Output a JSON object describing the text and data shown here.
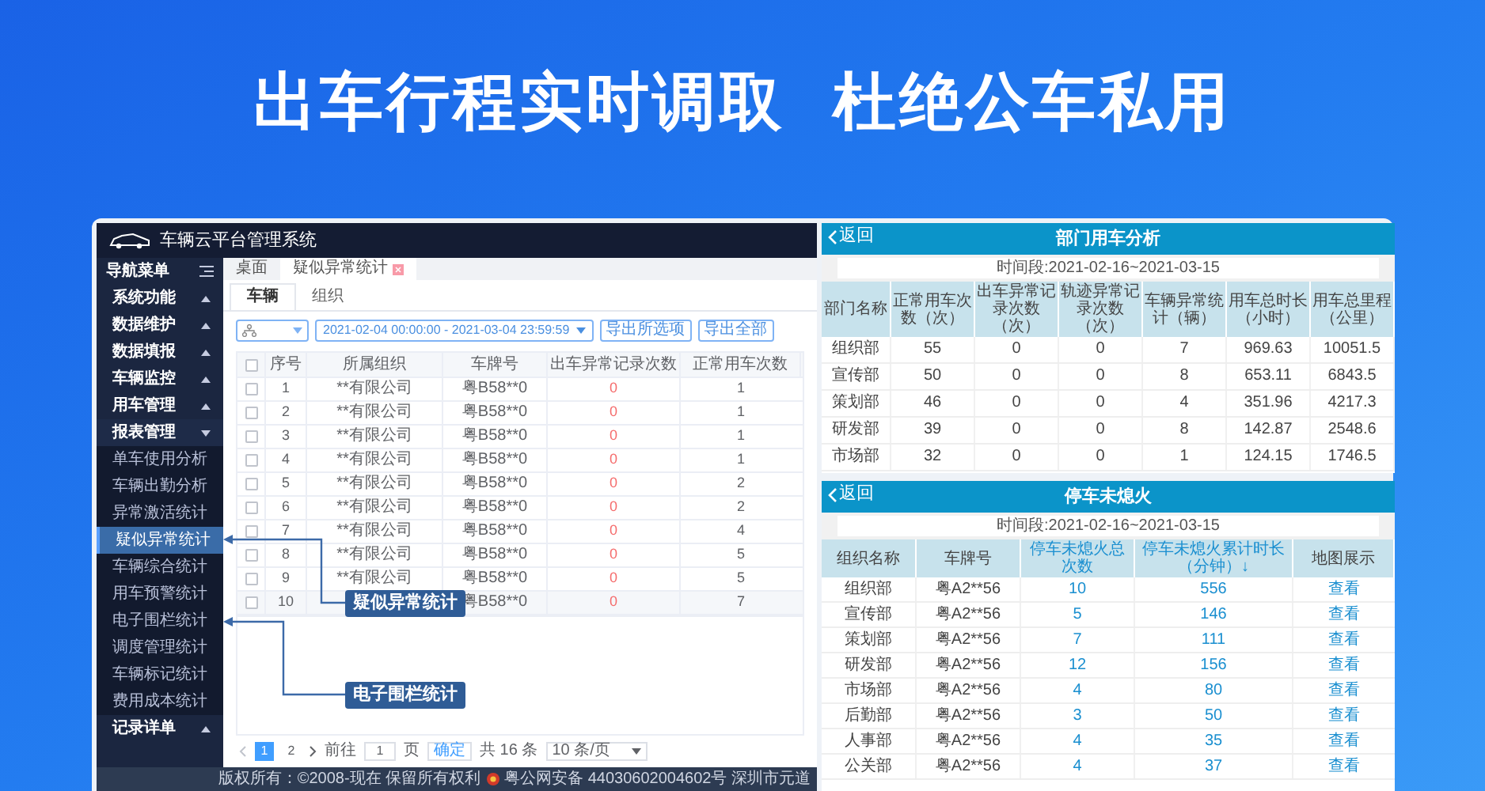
{
  "headline": [
    "出车行程实时调取",
    "杜绝公车私用"
  ],
  "app": {
    "title": "车辆云平台管理系统",
    "sidebar": {
      "title": "导航菜单",
      "items": [
        {
          "label": "系统功能",
          "expanded": false
        },
        {
          "label": "数据维护",
          "expanded": false
        },
        {
          "label": "数据填报",
          "expanded": false
        },
        {
          "label": "车辆监控",
          "expanded": false
        },
        {
          "label": "用车管理",
          "expanded": false
        },
        {
          "label": "报表管理",
          "expanded": true,
          "children": [
            {
              "label": "单车使用分析",
              "selected": false
            },
            {
              "label": "车辆出勤分析",
              "selected": false
            },
            {
              "label": "异常激活统计",
              "selected": false
            },
            {
              "label": "疑似异常统计",
              "selected": true
            },
            {
              "label": "车辆综合统计",
              "selected": false
            },
            {
              "label": "用车预警统计",
              "selected": false
            },
            {
              "label": "电子围栏统计",
              "selected": false
            },
            {
              "label": "调度管理统计",
              "selected": false
            },
            {
              "label": "车辆标记统计",
              "selected": false
            },
            {
              "label": "费用成本统计",
              "selected": false
            }
          ]
        },
        {
          "label": "记录详单",
          "expanded": false
        }
      ]
    },
    "page_tabs": [
      {
        "label": "桌面",
        "selected": false,
        "closable": false
      },
      {
        "label": "疑似异常统计",
        "selected": true,
        "closable": true
      }
    ],
    "view_tabs": [
      {
        "label": "车辆",
        "selected": true
      },
      {
        "label": "组织",
        "selected": false
      }
    ],
    "filters": {
      "date_range": "2021-02-04 00:00:00 - 2021-03-04 23:59:59",
      "buttons": [
        "导出所选项",
        "导出全部"
      ]
    },
    "table": {
      "all_checked": false,
      "columns": [
        "序号",
        "所属组织",
        "车牌号",
        "出车异常记录次数",
        "正常用车次数"
      ],
      "rows": [
        {
          "checked": false,
          "no": "1",
          "org": "**有限公司",
          "plate": "粤B58**0",
          "abnormal": "0",
          "normal": "1"
        },
        {
          "checked": false,
          "no": "2",
          "org": "**有限公司",
          "plate": "粤B58**0",
          "abnormal": "0",
          "normal": "1"
        },
        {
          "checked": false,
          "no": "3",
          "org": "**有限公司",
          "plate": "粤B58**0",
          "abnormal": "0",
          "normal": "1"
        },
        {
          "checked": false,
          "no": "4",
          "org": "**有限公司",
          "plate": "粤B58**0",
          "abnormal": "0",
          "normal": "1"
        },
        {
          "checked": false,
          "no": "5",
          "org": "**有限公司",
          "plate": "粤B58**0",
          "abnormal": "0",
          "normal": "2"
        },
        {
          "checked": false,
          "no": "6",
          "org": "**有限公司",
          "plate": "粤B58**0",
          "abnormal": "0",
          "normal": "2"
        },
        {
          "checked": false,
          "no": "7",
          "org": "**有限公司",
          "plate": "粤B58**0",
          "abnormal": "0",
          "normal": "4"
        },
        {
          "checked": false,
          "no": "8",
          "org": "**有限公司",
          "plate": "粤B58**0",
          "abnormal": "0",
          "normal": "5"
        },
        {
          "checked": false,
          "no": "9",
          "org": "**有限公司",
          "plate": "粤B58**0",
          "abnormal": "0",
          "normal": "5"
        },
        {
          "checked": false,
          "no": "10",
          "plate": "粤B58**0",
          "abnormal": "0",
          "normal": "7"
        }
      ]
    },
    "pagination": {
      "pages": [
        {
          "label": "1",
          "selected": true
        },
        {
          "label": "2",
          "selected": false
        }
      ],
      "goto_label": "前往",
      "goto_value": "1",
      "page_unit": "页",
      "confirm": "确定",
      "total": "共 16 条",
      "page_size": "10 条/页"
    },
    "footer": {
      "copyright": "版权所有：©2008-现在 保留所有权利",
      "record": "粤公网安备 44030602004602号 深圳市元道"
    },
    "callouts": [
      "疑似异常统计",
      "电子围栏统计"
    ]
  },
  "panels": [
    {
      "back": "返回",
      "title": "部门用车分析",
      "period": "时间段:2021-02-16~2021-03-15",
      "columns": [
        {
          "label": "部门名称",
          "kind": "text"
        },
        {
          "label": "正常用车次数（次）",
          "kind": "text"
        },
        {
          "label": "出车异常记录次数（次）",
          "kind": "text"
        },
        {
          "label": "轨迹异常记录次数（次）",
          "kind": "text"
        },
        {
          "label": "车辆异常统计（辆）",
          "kind": "text"
        },
        {
          "label": "用车总时长（小时）",
          "kind": "text"
        },
        {
          "label": "用车总里程（公里）",
          "kind": "text"
        }
      ],
      "rows": [
        [
          "组织部",
          "55",
          "0",
          "0",
          "7",
          "969.63",
          "10051.5"
        ],
        [
          "宣传部",
          "50",
          "0",
          "0",
          "8",
          "653.11",
          "6843.5"
        ],
        [
          "策划部",
          "46",
          "0",
          "0",
          "4",
          "351.96",
          "4217.3"
        ],
        [
          "研发部",
          "39",
          "0",
          "0",
          "8",
          "142.87",
          "2548.6"
        ],
        [
          "市场部",
          "32",
          "0",
          "0",
          "1",
          "124.15",
          "1746.5"
        ]
      ]
    },
    {
      "back": "返回",
      "title": "停车未熄火",
      "period": "时间段:2021-02-16~2021-03-15",
      "columns": [
        {
          "label": "组织名称",
          "kind": "text"
        },
        {
          "label": "车牌号",
          "kind": "text"
        },
        {
          "label": "停车未熄火总次数",
          "kind": "metric"
        },
        {
          "label": "停车未熄火累计时长（分钟）↓",
          "kind": "metric"
        },
        {
          "label": "地图展示",
          "kind": "link"
        }
      ],
      "rows": [
        [
          "组织部",
          "粤A2**56",
          "10",
          "556",
          "查看"
        ],
        [
          "宣传部",
          "粤A2**56",
          "5",
          "146",
          "查看"
        ],
        [
          "策划部",
          "粤A2**56",
          "7",
          "111",
          "查看"
        ],
        [
          "研发部",
          "粤A2**56",
          "12",
          "156",
          "查看"
        ],
        [
          "市场部",
          "粤A2**56",
          "4",
          "80",
          "查看"
        ],
        [
          "后勤部",
          "粤A2**56",
          "3",
          "50",
          "查看"
        ],
        [
          "人事部",
          "粤A2**56",
          "4",
          "35",
          "查看"
        ],
        [
          "公关部",
          "粤A2**56",
          "4",
          "37",
          "查看"
        ]
      ]
    }
  ]
}
